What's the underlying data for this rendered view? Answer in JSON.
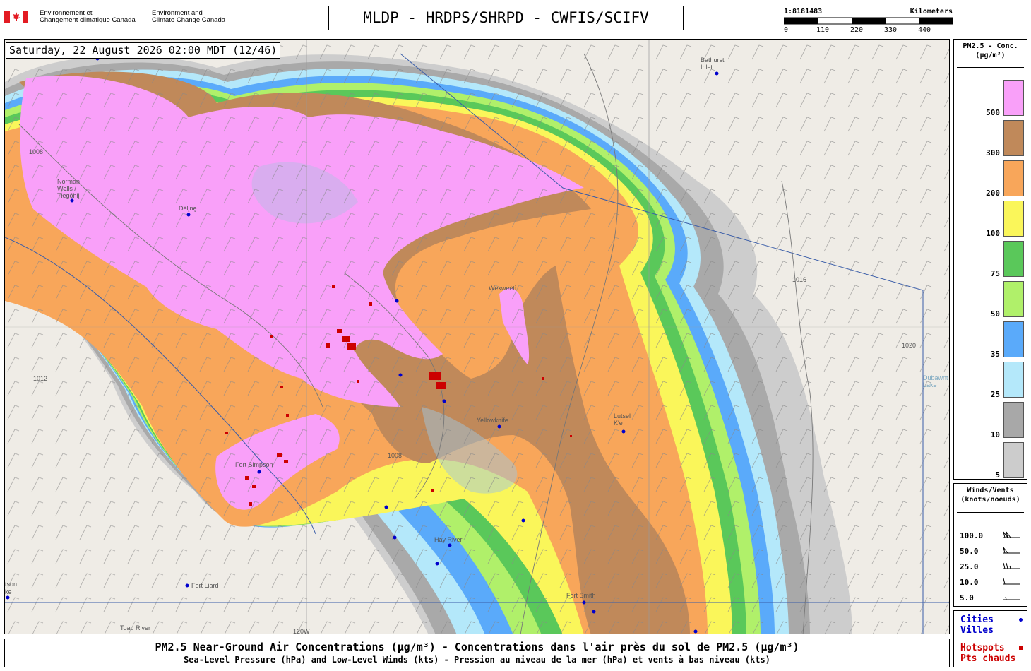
{
  "header": {
    "dept_fr": [
      "Environnement et",
      "Changement climatique Canada"
    ],
    "dept_en": [
      "Environment and",
      "Climate Change Canada"
    ],
    "title": "MLDP - HRDPS/SHRPD - CWFIS/SCIFV"
  },
  "scale": {
    "ratio": "1:8181483",
    "unit": "Kilometers",
    "ticks": [
      "0",
      "110",
      "220",
      "330",
      "440"
    ]
  },
  "map": {
    "timestamp": "Saturday, 22 August 2026 02:00 MDT (12/46)",
    "cities": [
      {
        "name": "Bathurst Inlet",
        "lines": [
          "Bathurst",
          "Inlet"
        ]
      },
      {
        "name": "Norman Wells",
        "lines": [
          "Norman",
          "Wells /",
          "Tłegóhłį"
        ]
      },
      {
        "name": "Délįnę",
        "lines": [
          "Délįnę"
        ]
      },
      {
        "name": "Wekweètì",
        "lines": [
          "Wekweètì"
        ]
      },
      {
        "name": "Yellowknife",
        "lines": [
          "Yellowknife"
        ]
      },
      {
        "name": "Lutsel K'e",
        "lines": [
          "Lutsel",
          "K'e"
        ]
      },
      {
        "name": "Fort Simpson",
        "lines": [
          "Fort Simpson"
        ]
      },
      {
        "name": "Hay River",
        "lines": [
          "Hay River"
        ]
      },
      {
        "name": "Fort Liard",
        "lines": [
          "Fort Liard"
        ]
      },
      {
        "name": "Fort Smith",
        "lines": [
          "Fort Smith"
        ]
      },
      {
        "name": "Toad River",
        "lines": [
          "Toad River"
        ]
      },
      {
        "name": "Watson Lake",
        "lines": [
          "tson",
          "ke"
        ]
      },
      {
        "name": "Dubawnt Lake",
        "lines": [
          "Dubawnt",
          "Lake"
        ]
      }
    ],
    "isobars": [
      "1008",
      "1012",
      "1016",
      "1020"
    ],
    "meridian": "120W",
    "colors": {
      "city_dot": "#0000cc",
      "hotspot": "#cc0000"
    }
  },
  "legend_pm": {
    "title": [
      "PM2.5 - Conc.",
      "(µg/m³)"
    ],
    "levels": [
      {
        "label": "500",
        "color": "#f9a0f9"
      },
      {
        "label": "300",
        "color": "#c0895a"
      },
      {
        "label": "200",
        "color": "#f8a65a"
      },
      {
        "label": "100",
        "color": "#faf65a"
      },
      {
        "label": "75",
        "color": "#5ac85a"
      },
      {
        "label": "50",
        "color": "#b0f06a"
      },
      {
        "label": "35",
        "color": "#5aaafa"
      },
      {
        "label": "25",
        "color": "#b4e8fa"
      },
      {
        "label": "10",
        "color": "#a8a8a8"
      },
      {
        "label": "5",
        "color": "#cccccc"
      }
    ]
  },
  "legend_wind": {
    "title": [
      "Winds/Vents",
      "(knots/noeuds)"
    ],
    "rows": [
      "100.0",
      "50.0",
      "25.0",
      "10.0",
      "5.0"
    ]
  },
  "legend_cities": {
    "cities_en": "Cities",
    "cities_fr": "Villes",
    "hotspots_en": "Hotspots",
    "hotspots_fr": "Pts chauds"
  },
  "footer": {
    "line1": "PM2.5 Near-Ground Air Concentrations (µg/m³) - Concentrations dans l'air près du sol de PM2.5 (µg/m³)",
    "line2": "Sea-Level Pressure (hPa) and Low-Level Winds (kts) - Pression au niveau de la mer (hPa) et vents à bas niveau (kts)"
  }
}
